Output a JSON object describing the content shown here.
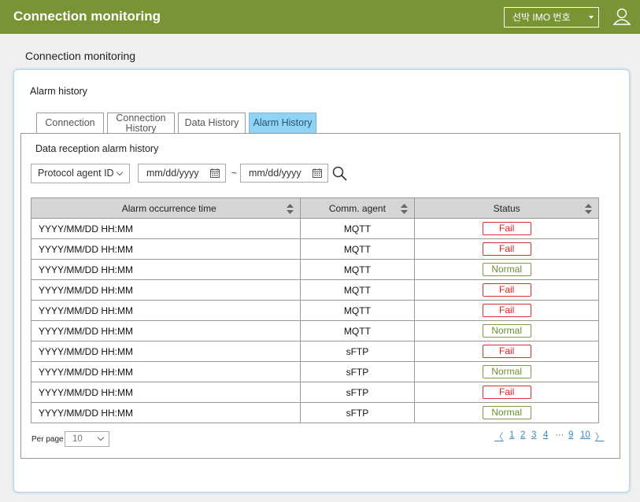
{
  "header": {
    "app_title": "Connection monitoring",
    "ship_select": "선박 IMO 번호"
  },
  "page": {
    "title": "Connection monitoring"
  },
  "panel": {
    "title": "Alarm history"
  },
  "tabs": [
    {
      "label": "Connection",
      "active": false
    },
    {
      "label_line1": "Connection",
      "label_line2": "History",
      "active": false
    },
    {
      "label": "Data History",
      "active": false
    },
    {
      "label": "Alarm History",
      "active": true
    }
  ],
  "filter": {
    "subtitle": "Data reception alarm history",
    "agent_select": "Protocol agent ID",
    "date_from": "mm/dd/yyyy",
    "date_to": "mm/dd/yyyy",
    "tilde": "~"
  },
  "table": {
    "headers": [
      "Alarm occurrence time",
      "Comm. agent",
      "Status"
    ],
    "rows": [
      {
        "time": "YYYY/MM/DD HH:MM",
        "agent": "MQTT",
        "status": "Fail"
      },
      {
        "time": "YYYY/MM/DD HH:MM",
        "agent": "MQTT",
        "status": "Fail"
      },
      {
        "time": "YYYY/MM/DD HH:MM",
        "agent": "MQTT",
        "status": "Normal"
      },
      {
        "time": "YYYY/MM/DD HH:MM",
        "agent": "MQTT",
        "status": "Fail"
      },
      {
        "time": "YYYY/MM/DD HH:MM",
        "agent": "MQTT",
        "status": "Fail"
      },
      {
        "time": "YYYY/MM/DD HH:MM",
        "agent": "MQTT",
        "status": "Normal"
      },
      {
        "time": "YYYY/MM/DD HH:MM",
        "agent": "sFTP",
        "status": "Fail"
      },
      {
        "time": "YYYY/MM/DD HH:MM",
        "agent": "sFTP",
        "status": "Normal"
      },
      {
        "time": "YYYY/MM/DD HH:MM",
        "agent": "sFTP",
        "status": "Fail"
      },
      {
        "time": "YYYY/MM/DD HH:MM",
        "agent": "sFTP",
        "status": "Normal"
      }
    ]
  },
  "pagination": {
    "per_page_label": "Per page",
    "per_page_value": "10",
    "prev": "〈",
    "pages": [
      "1",
      "2",
      "3",
      "4"
    ],
    "ellipsis": "···",
    "tail_pages": [
      "9",
      "10"
    ],
    "next": "〉"
  },
  "colors": {
    "header_bg": "#799434",
    "active_tab": "#8fd4f5",
    "fail": "#e02020",
    "normal": "#6b9030",
    "link": "#3b8ac4"
  },
  "icons": {
    "user": "user-icon",
    "search": "search-icon",
    "calendar": "calendar-icon",
    "sort": "sort-icon"
  }
}
